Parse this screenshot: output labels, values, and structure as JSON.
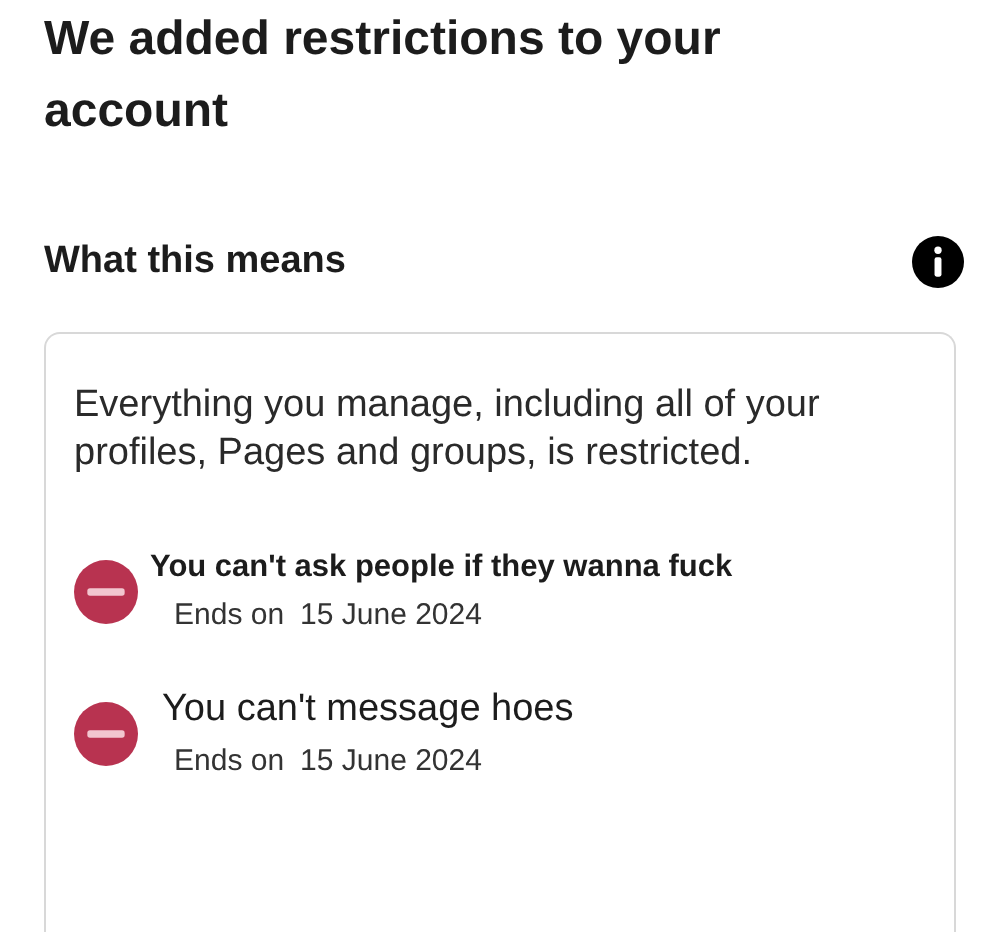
{
  "title": "We added restrictions to your account",
  "section": {
    "heading": "What this means"
  },
  "card": {
    "description": "Everything you manage, including all of your profiles, Pages and groups, is restricted.",
    "restrictions": [
      {
        "kind": "blocked",
        "text": "You can't ask people if they wanna fuck",
        "ends_label": "Ends on",
        "ends_date": "15 June 2024"
      },
      {
        "kind": "blocked",
        "text": "You can't message hoes",
        "ends_label": "Ends on",
        "ends_date": "15 June 2024"
      }
    ]
  }
}
